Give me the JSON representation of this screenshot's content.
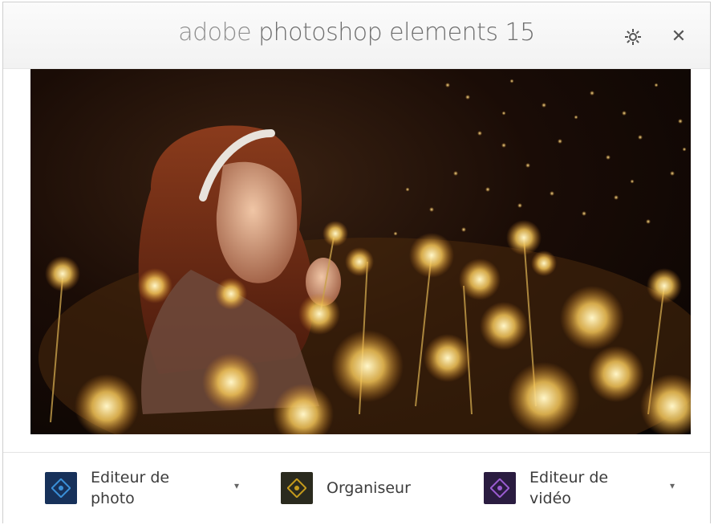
{
  "window": {
    "title_brand": "adobe",
    "title_product": "photoshop elements 15",
    "settings_icon": "gear-icon",
    "close_icon": "close-icon",
    "close_glyph": "✕"
  },
  "hero": {
    "image": "girl-blowing-dandelions-photo"
  },
  "launchers": [
    {
      "line1": "Editeur de",
      "line2": "photo",
      "icon": "photo-editor-icon",
      "icon_color": "#1e3f73",
      "accent": "#3a8fd8",
      "has_dropdown": true,
      "caret": "▾"
    },
    {
      "line1": "Organiseur",
      "line2": "",
      "icon": "organizer-icon",
      "icon_color": "#2a2a1a",
      "accent": "#c49a1c",
      "has_dropdown": false
    },
    {
      "line1": "Editeur de",
      "line2": "vidéo",
      "icon": "video-editor-icon",
      "icon_color": "#2e1e45",
      "accent": "#9a5bd0",
      "has_dropdown": true,
      "caret": "▾"
    }
  ]
}
